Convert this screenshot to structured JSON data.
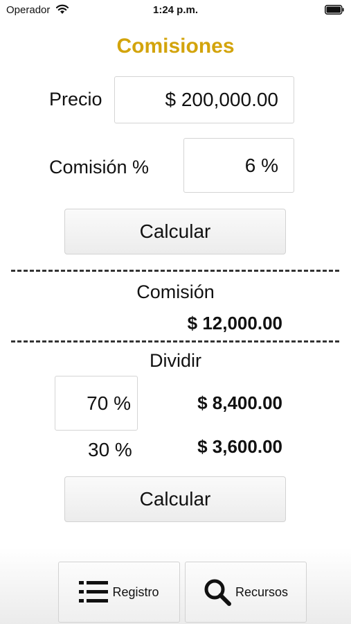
{
  "status_bar": {
    "carrier": "Operador",
    "time": "1:24 p.m."
  },
  "title": "Comisiones",
  "precio": {
    "label": "Precio",
    "value": "$ 200,000.00"
  },
  "comision_pct": {
    "label": "Comisión %",
    "value": "6 %"
  },
  "calc_button_1": "Calcular",
  "comision_result": {
    "label": "Comisión",
    "amount": "$ 12,000.00"
  },
  "dividir": {
    "label": "Dividir",
    "split_1": {
      "pct": "70 %",
      "amount": "$ 8,400.00"
    },
    "split_2": {
      "pct": "30 %",
      "amount": "$ 3,600.00"
    }
  },
  "calc_button_2": "Calcular",
  "tabs": [
    {
      "label": "Registro",
      "icon": "list-icon"
    },
    {
      "label": "Recursos",
      "icon": "search-icon"
    }
  ],
  "colors": {
    "title": "#d3a40c"
  }
}
